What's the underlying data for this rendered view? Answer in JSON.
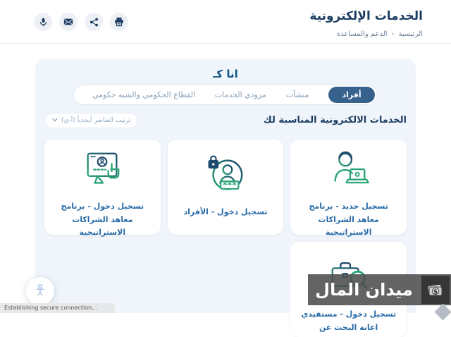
{
  "header": {
    "title": "الخدمات الإلكترونية",
    "breadcrumb": {
      "home": "الرئيسية",
      "separator": "‹",
      "current": "الدعم والمساعدة"
    },
    "actions": [
      {
        "icon": "microphone-icon"
      },
      {
        "icon": "email-icon"
      },
      {
        "icon": "share-icon"
      },
      {
        "icon": "print-icon"
      }
    ]
  },
  "panel": {
    "heading": "انا كـ",
    "tabs": [
      {
        "label": "أفراد",
        "selected": true
      },
      {
        "label": "منشآت",
        "selected": false
      },
      {
        "label": "مزودي الخدمات",
        "selected": false
      },
      {
        "label": "القطاع الحكومي والشبه حكومي",
        "selected": false
      }
    ],
    "section_title": "الخدمات الالكترونية المناسبة لك",
    "sort_button": {
      "label": "ترتيب العناصر أبجدياً (أ-ي)",
      "icon": "chevron-down-icon"
    },
    "cards": [
      {
        "label": "تسجيل جديد - برنامج معاهد الشراكات الاستراتيجية",
        "icon": "agent-laptop-icon"
      },
      {
        "label": "تسجيل دخول - الأفراد",
        "icon": "user-lock-icon",
        "password_mask": "***"
      },
      {
        "label": "تسجيل دخول - برنامج معاهد الشراكات الاستراتيجية",
        "icon": "monitor-login-icon"
      },
      {
        "label": "تسجيل دخول - مستفيدي اعانة البحث عن",
        "icon": "briefcase-search-icon"
      }
    ]
  },
  "watermark": {
    "text": "ميدان المال",
    "logo": "money-stack-icon",
    "currency": "$"
  },
  "status_bar": {
    "text": "Establishing secure connection..."
  },
  "floating_button": {
    "icon": "accessibility-icon"
  },
  "colors": {
    "navy": "#1d3e63",
    "tab_selected_bg": "#35618c",
    "card_text": "#2a6ca8",
    "panel_bg": "#f0f5fb",
    "icon_green": "#2aa577",
    "icon_navy": "#1d4a6e"
  }
}
